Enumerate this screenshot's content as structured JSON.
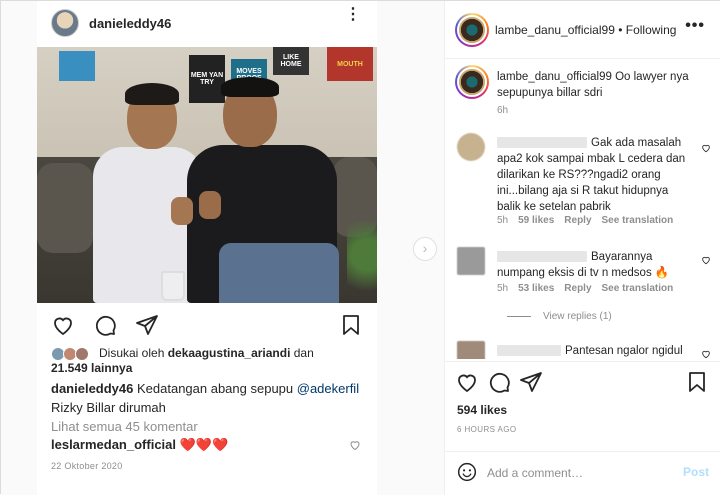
{
  "inner_post": {
    "username": "danieleddy46",
    "more": "⋮",
    "posters": {
      "p1": "MOVES PROOF",
      "p2": "MEM YAN TRY",
      "p3": "LIKE HOME",
      "p4": "MOUTH"
    },
    "likes_prefix": "Disukai oleh ",
    "likes_user": "dekaagustina_ariandi",
    "likes_mid": " dan",
    "likes_count": "21.549 lainnya",
    "caption_user": "danieleddy46",
    "caption_text": " Kedatangan abang sepupu ",
    "caption_mention": "@adekerfil",
    "caption_text2": "Rizky Billar dirumah",
    "view_all": "Lihat semua 45 komentar",
    "comment_user": "leslarmedan_official",
    "comment_hearts": "❤️❤️❤️",
    "date": "22 Oktober 2020"
  },
  "next_arrow": "›",
  "right": {
    "username": "lambe_danu_official99",
    "dot": " • ",
    "following": "Following",
    "more": "•••",
    "caption_user": "lambe_danu_official99",
    "caption_text": " Oo lawyer nya sepupunya billar sdri",
    "caption_time": "6h",
    "comments": [
      {
        "text": "Gak ada masalah apa2 kok sampai mbak L cedera dan dilarikan ke RS???ngadi2 orang ini...bilang aja si R takut hidupnya balik ke setelan pabrik",
        "time": "5h",
        "likes": "59 likes",
        "reply": "Reply",
        "translate": "See translation"
      },
      {
        "text": "Bayarannya numpang eksis di tv n medsos 🔥",
        "time": "5h",
        "likes": "53 likes",
        "reply": "Reply",
        "translate": "See translation"
      },
      {
        "text": "Pantesan ngalor ngidul"
      }
    ],
    "view_replies": "View replies (1)",
    "likes": "594 likes",
    "time_ago": "6 HOURS AGO",
    "add_placeholder": "Add a comment…",
    "post_label": "Post"
  },
  "colors": {
    "heart_red": "#ed4956",
    "post_blue_disabled": "#b2dffc",
    "link": "#00376b",
    "muted": "#8e8e8e"
  }
}
